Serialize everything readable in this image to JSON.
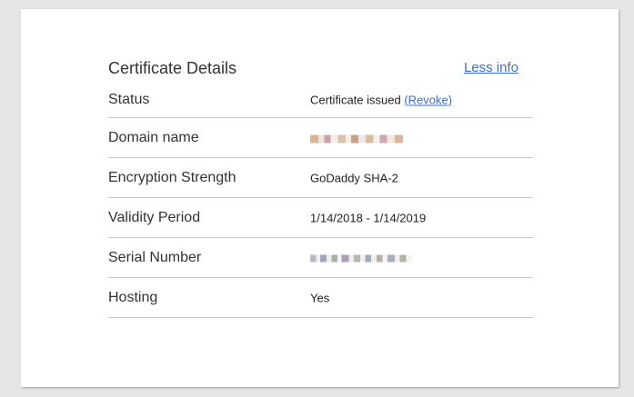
{
  "card": {
    "title": "Certificate Details",
    "less_info_link": "Less info"
  },
  "rows": [
    {
      "label": "Status",
      "value": "Certificate issued",
      "action": "(Revoke)"
    },
    {
      "label": "Domain name",
      "value": ""
    },
    {
      "label": "Encryption Strength",
      "value": "GoDaddy SHA-2"
    },
    {
      "label": "Validity Period",
      "value": "1/14/2018 - 1/14/2019"
    },
    {
      "label": "Serial Number",
      "value": ""
    },
    {
      "label": "Hosting",
      "value": "Yes"
    }
  ]
}
